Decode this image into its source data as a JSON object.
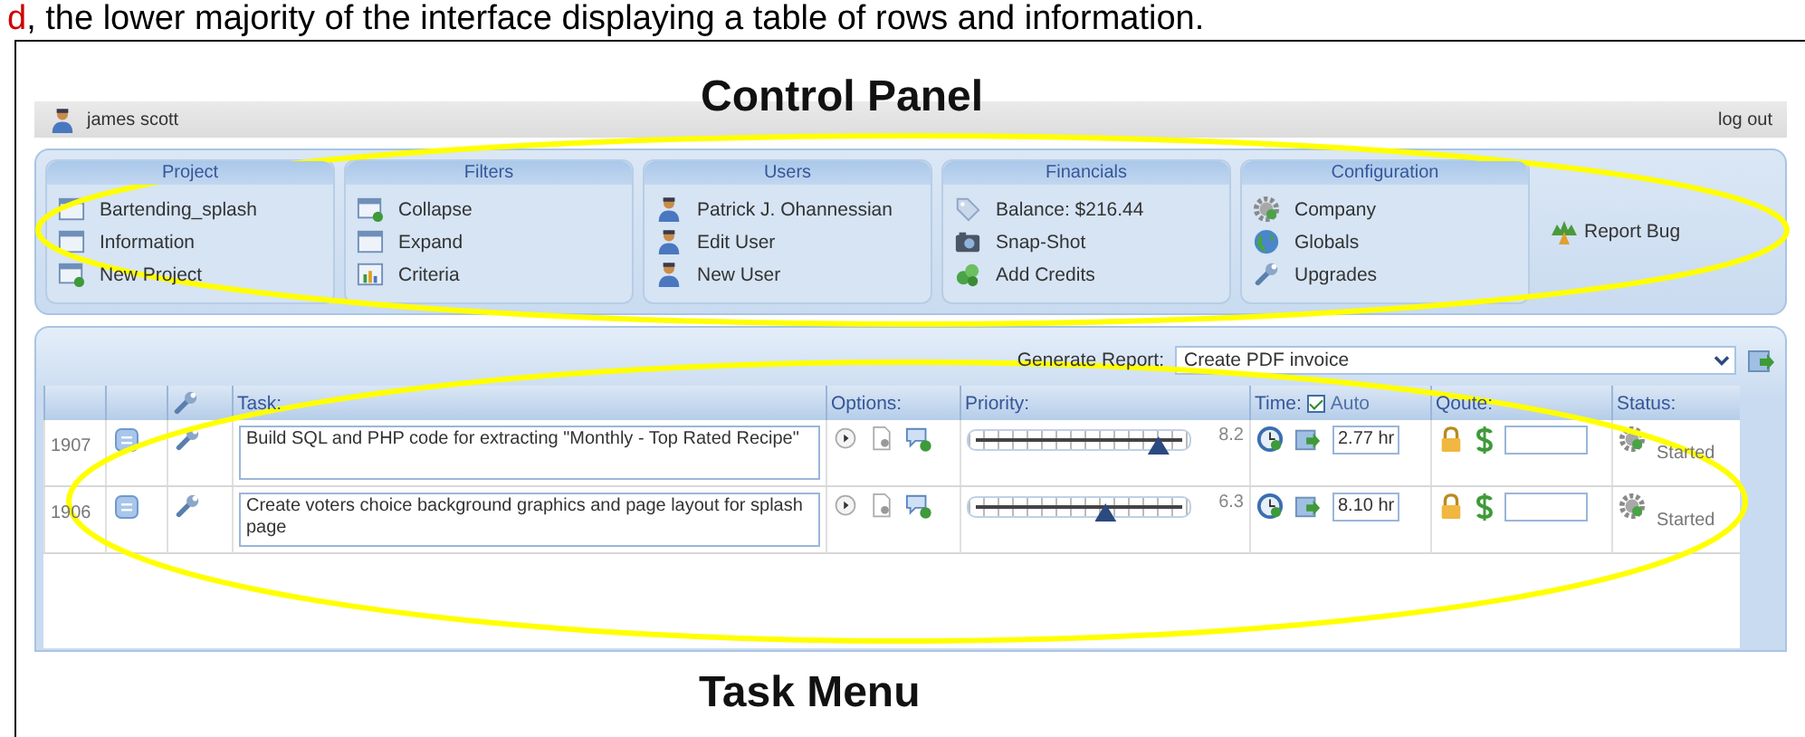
{
  "caption": [
    {
      "text": "d",
      "color": "#d00000"
    },
    {
      "text": ", the lower majority of the interface displaying a table of rows and information.",
      "color": "#000000"
    }
  ],
  "annotations": [
    {
      "label": "Control Panel"
    },
    {
      "label": "Task Menu"
    }
  ],
  "user": {
    "name": "james scott"
  },
  "logout": "log out",
  "control_panel": {
    "groups": [
      {
        "title": "Project",
        "items": [
          "Bartending_splash",
          "Information",
          "New Project"
        ]
      },
      {
        "title": "Filters",
        "items": [
          "Collapse",
          "Expand",
          "Criteria"
        ]
      },
      {
        "title": "Users",
        "items": [
          "Patrick J. Ohannessian",
          "Edit User",
          "New User"
        ]
      },
      {
        "title": "Financials",
        "items": [
          "Balance: $216.44",
          "Snap-Shot",
          "Add Credits"
        ]
      },
      {
        "title": "Configuration",
        "items": [
          "Company",
          "Globals",
          "Upgrades"
        ]
      }
    ],
    "report_bug": "Report Bug"
  },
  "report": {
    "label": "Generate Report:",
    "value": "Create PDF invoice"
  },
  "table": {
    "columns": [
      "Task:",
      "Options:",
      "Priority:",
      "Time:",
      "Qoute:",
      "Status:"
    ],
    "time_auto": {
      "label": "Auto",
      "checked": true
    },
    "rows": [
      {
        "id": "1907",
        "task": "Build SQL and PHP code for extracting \"Monthly - Top Rated Recipe\"",
        "level": 0.86,
        "reading": "8.2",
        "time": "2.77 hr",
        "status": "Started"
      },
      {
        "id": "1906",
        "task": "Create voters choice background graphics and page layout for splash page",
        "level": 0.62,
        "reading": "6.3",
        "time": "8.10 hr",
        "status": "Started"
      }
    ]
  }
}
